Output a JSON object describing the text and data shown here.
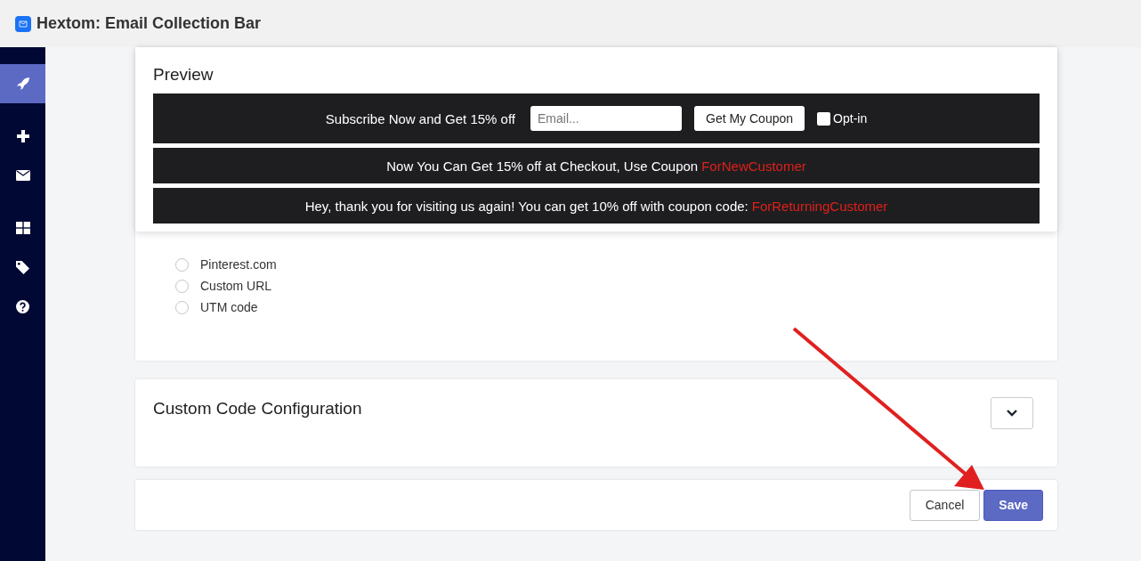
{
  "app": {
    "title": "Hextom: Email Collection Bar"
  },
  "sidebar": {
    "items": [
      {
        "kind": "rocket",
        "selected": true
      },
      {
        "kind": "plus",
        "selected": false
      },
      {
        "kind": "mail",
        "selected": false
      },
      {
        "kind": "grid",
        "selected": false
      },
      {
        "kind": "tag",
        "selected": false
      },
      {
        "kind": "help",
        "selected": false
      }
    ]
  },
  "preview": {
    "title": "Preview",
    "subscribe_bar": {
      "text": "Subscribe Now and Get 15% off",
      "placeholder": "Email...",
      "button": "Get My Coupon",
      "checkbox_label": "Opt-in",
      "checked": false
    },
    "bars": [
      {
        "text": "Now You Can Get 15% off at Checkout, Use Coupon",
        "code": "ForNewCustomer"
      },
      {
        "text": "Hey, thank you for visiting us again! You can get 10% off with coupon code:",
        "code": "ForReturningCustomer"
      }
    ]
  },
  "source_options": [
    {
      "label": "Pinterest.com",
      "selected": false
    },
    {
      "label": "Custom URL",
      "selected": false
    },
    {
      "label": "UTM code",
      "selected": false
    }
  ],
  "custom_code": {
    "title": "Custom Code Configuration",
    "expanded": false
  },
  "footer": {
    "cancel": "Cancel",
    "save": "Save"
  }
}
